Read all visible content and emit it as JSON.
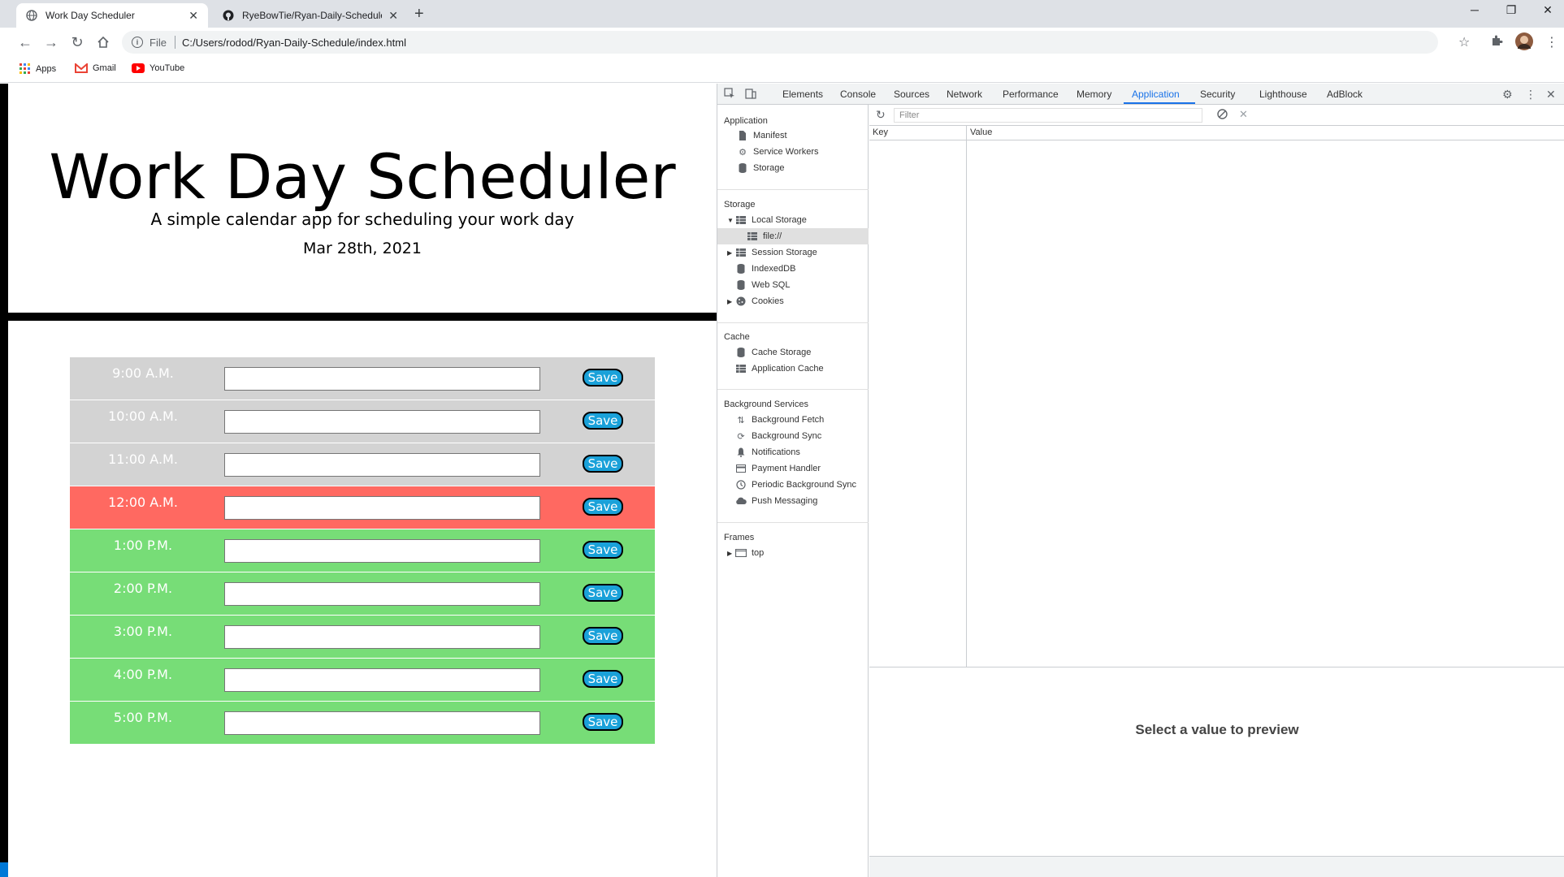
{
  "browser": {
    "tabs": [
      {
        "title": "Work Day Scheduler",
        "active": true,
        "icon": "globe-icon"
      },
      {
        "title": "RyeBowTie/Ryan-Daily-Schedule",
        "active": false,
        "icon": "github-icon"
      }
    ],
    "new_tab": "+",
    "window_controls": {
      "minimize": "─",
      "restore": "❐",
      "close": "✕"
    },
    "address": {
      "scheme": "File",
      "url": "C:/Users/rodod/Ryan-Daily-Schedule/index.html"
    },
    "bookmarks": [
      {
        "label": "Apps",
        "icon": "apps-grid-icon"
      },
      {
        "label": "Gmail",
        "icon": "gmail-icon"
      },
      {
        "label": "YouTube",
        "icon": "youtube-icon"
      }
    ]
  },
  "app": {
    "title": "Work Day Scheduler",
    "subtitle": "A simple calendar app for scheduling your work day",
    "current_day": "Mar 28th, 2021",
    "save_label": "Save",
    "time_blocks": [
      {
        "hour": "9:00 A.M.",
        "state": "past",
        "value": ""
      },
      {
        "hour": "10:00 A.M.",
        "state": "past",
        "value": ""
      },
      {
        "hour": "11:00 A.M.",
        "state": "past",
        "value": ""
      },
      {
        "hour": "12:00 A.M.",
        "state": "present",
        "value": ""
      },
      {
        "hour": "1:00 P.M.",
        "state": "future",
        "value": ""
      },
      {
        "hour": "2:00 P.M.",
        "state": "future",
        "value": ""
      },
      {
        "hour": "3:00 P.M.",
        "state": "future",
        "value": ""
      },
      {
        "hour": "4:00 P.M.",
        "state": "future",
        "value": ""
      },
      {
        "hour": "5:00 P.M.",
        "state": "future",
        "value": ""
      }
    ],
    "colors": {
      "past": "#d3d3d3",
      "present": "#ff6961",
      "future": "#77dd77",
      "save": "#1aa1d9"
    }
  },
  "devtools": {
    "tabs": [
      "Elements",
      "Console",
      "Sources",
      "Network",
      "Performance",
      "Memory",
      "Application",
      "Security",
      "Lighthouse",
      "AdBlock"
    ],
    "active_tab": "Application",
    "sidebar": {
      "application_header": "Application",
      "application_items": [
        "Manifest",
        "Service Workers",
        "Storage"
      ],
      "storage_header": "Storage",
      "local_storage": "Local Storage",
      "local_storage_child": "file://",
      "storage_items": [
        "Session Storage",
        "IndexedDB",
        "Web SQL",
        "Cookies"
      ],
      "cache_header": "Cache",
      "cache_items": [
        "Cache Storage",
        "Application Cache"
      ],
      "background_header": "Background Services",
      "background_items": [
        "Background Fetch",
        "Background Sync",
        "Notifications",
        "Payment Handler",
        "Periodic Background Sync",
        "Push Messaging"
      ],
      "frames_header": "Frames",
      "frames_items": [
        "top"
      ]
    },
    "filter_placeholder": "Filter",
    "table": {
      "key_header": "Key",
      "value_header": "Value"
    },
    "preview_text": "Select a value to preview"
  }
}
